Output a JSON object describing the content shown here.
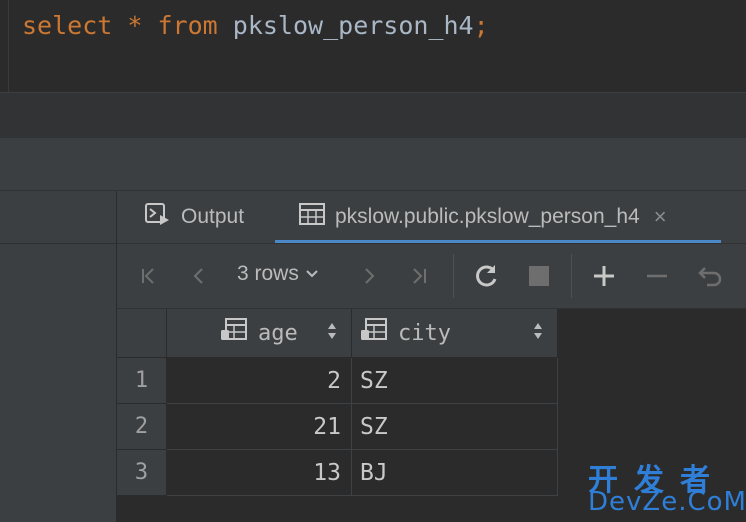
{
  "editor": {
    "keyword_select": "select",
    "operator_star": "*",
    "keyword_from": "from",
    "table_name": "pkslow_person_h4",
    "terminator": ";"
  },
  "tabs": {
    "output_label": "Output",
    "table_label": "pkslow.public.pkslow_person_h4",
    "close_glyph": "×"
  },
  "toolbar": {
    "rows_label": "3 rows",
    "rows_chevron": "⌄"
  },
  "grid": {
    "columns": [
      "age",
      "city"
    ],
    "rows": [
      {
        "num": "1",
        "age": "2",
        "city": "SZ"
      },
      {
        "num": "2",
        "age": "21",
        "city": "SZ"
      },
      {
        "num": "3",
        "age": "13",
        "city": "BJ"
      }
    ]
  },
  "watermark": {
    "top": "开发者",
    "bottom": "DevZe.CoM"
  },
  "colors": {
    "keyword": "#cc7832",
    "identifier": "#a9b7c6",
    "active_tab_underline": "#4a88c7",
    "watermark": "#2f7fd8"
  },
  "icons": {
    "output_tab": "console-output-icon",
    "table_tab": "table-grid-icon",
    "first_page": "first-page-icon",
    "prev_page": "previous-page-icon",
    "next_page": "next-page-icon",
    "last_page": "last-page-icon",
    "reload": "reload-icon",
    "stop": "stop-icon",
    "add_row": "add-row-icon",
    "delete_row": "delete-row-icon",
    "revert": "revert-icon",
    "column": "column-icon",
    "sort": "sort-icon"
  }
}
